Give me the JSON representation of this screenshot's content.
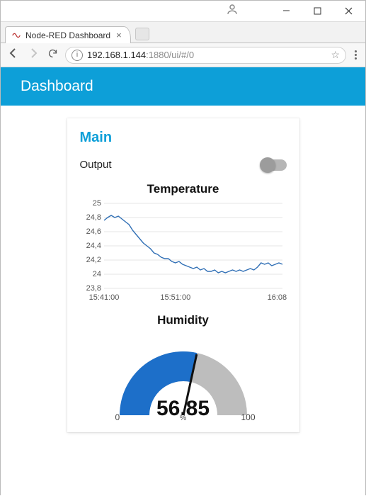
{
  "window": {
    "tab_title": "Node-RED Dashboard",
    "url_host": "192.168.1.144",
    "url_path": ":1880/ui/#/0"
  },
  "appbar": {
    "title": "Dashboard"
  },
  "card": {
    "title": "Main",
    "output_label": "Output",
    "output_on": false
  },
  "chart_data": {
    "type": "line",
    "title": "Temperature",
    "xlabel": "",
    "ylabel": "",
    "ylim": [
      23.8,
      25.0
    ],
    "yticks": [
      "25",
      "24,8",
      "24,6",
      "24,4",
      "24,2",
      "24",
      "23,8"
    ],
    "xticks": [
      "15:41:00",
      "15:51:00",
      "16:08:00"
    ],
    "x": [
      0,
      2,
      4,
      6,
      8,
      10,
      12,
      14,
      16,
      18,
      20,
      22,
      24,
      26,
      28,
      30,
      32,
      34,
      36,
      38,
      40,
      42,
      44,
      46,
      48,
      50,
      52,
      54,
      56,
      58,
      60,
      62,
      64,
      66,
      68,
      70,
      72,
      74,
      76,
      78,
      80,
      82,
      84,
      86,
      88,
      90,
      92,
      94,
      96,
      98,
      100
    ],
    "values": [
      24.76,
      24.8,
      24.83,
      24.8,
      24.82,
      24.78,
      24.74,
      24.7,
      24.62,
      24.56,
      24.5,
      24.44,
      24.4,
      24.36,
      24.3,
      24.28,
      24.24,
      24.22,
      24.22,
      24.18,
      24.16,
      24.18,
      24.14,
      24.12,
      24.1,
      24.08,
      24.1,
      24.06,
      24.08,
      24.04,
      24.04,
      24.06,
      24.02,
      24.04,
      24.02,
      24.04,
      24.06,
      24.04,
      24.06,
      24.04,
      24.06,
      24.08,
      24.06,
      24.1,
      24.16,
      24.14,
      24.16,
      24.12,
      24.14,
      24.16,
      24.14
    ]
  },
  "gauge": {
    "title": "Humidity",
    "value": 56.85,
    "display": "56.85",
    "min": 0,
    "max": 100,
    "unit": "%"
  }
}
